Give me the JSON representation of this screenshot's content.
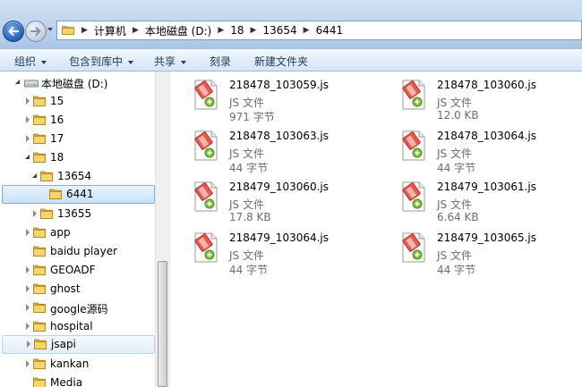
{
  "address": {
    "breadcrumbs": [
      "计算机",
      "本地磁盘 (D:)",
      "18",
      "13654",
      "6441"
    ]
  },
  "toolbar": {
    "organize": "组织",
    "include_library": "包含到库中",
    "share": "共享",
    "burn": "刻录",
    "new_folder": "新建文件夹"
  },
  "nav": {
    "drive": "本地磁盘 (D:)",
    "items": [
      {
        "label": "15"
      },
      {
        "label": "16"
      },
      {
        "label": "17"
      },
      {
        "label": "18"
      },
      {
        "label": "13654"
      },
      {
        "label": "6441"
      },
      {
        "label": "13655"
      },
      {
        "label": "app"
      },
      {
        "label": "baidu player"
      },
      {
        "label": "GEOADF"
      },
      {
        "label": "ghost"
      },
      {
        "label": "google源码"
      },
      {
        "label": "hospital"
      },
      {
        "label": "jsapi"
      },
      {
        "label": "kankan"
      },
      {
        "label": "Media"
      }
    ]
  },
  "files": [
    {
      "name": "218478_103059.js",
      "type": "JS 文件",
      "size": "971 字节"
    },
    {
      "name": "218478_103060.js",
      "type": "JS 文件",
      "size": "12.0 KB"
    },
    {
      "name": "218478_103063.js",
      "type": "JS 文件",
      "size": "44 字节"
    },
    {
      "name": "218478_103064.js",
      "type": "JS 文件",
      "size": "44 字节"
    },
    {
      "name": "218479_103060.js",
      "type": "JS 文件",
      "size": "17.8 KB"
    },
    {
      "name": "218479_103061.js",
      "type": "JS 文件",
      "size": "6.64 KB"
    },
    {
      "name": "218479_103064.js",
      "type": "JS 文件",
      "size": "44 字节"
    },
    {
      "name": "218479_103065.js",
      "type": "JS 文件",
      "size": "44 字节"
    }
  ],
  "icons": {
    "back": "back-arrow-icon",
    "forward": "forward-arrow-icon",
    "folder": "folder-icon",
    "drive": "drive-icon",
    "js_file": "js-file-icon"
  },
  "colors": {
    "selection": "#c7e2fb",
    "toolbar_text": "#1e395b",
    "secondary_text": "#6d6d6d"
  }
}
